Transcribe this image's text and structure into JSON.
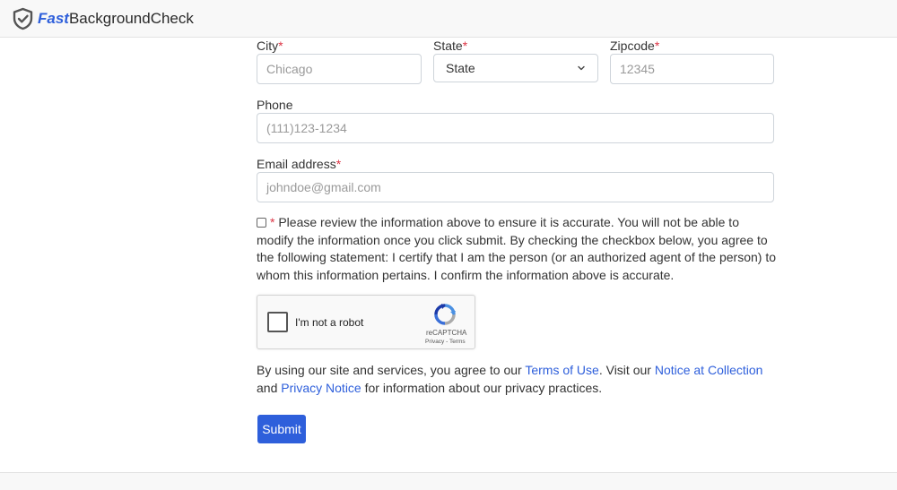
{
  "header": {
    "logo_fast": "Fast",
    "logo_rest": "BackgroundCheck",
    "brand_color": "#2e5fdb"
  },
  "form": {
    "city": {
      "label": "City",
      "required_mark": "*",
      "placeholder": "Chicago"
    },
    "state": {
      "label": "State",
      "required_mark": "*",
      "selected": "State"
    },
    "zipcode": {
      "label": "Zipcode",
      "required_mark": "*",
      "placeholder": "12345"
    },
    "phone": {
      "label": "Phone",
      "placeholder": "(111)123-1234"
    },
    "email": {
      "label": "Email address",
      "required_mark": "*",
      "placeholder": "johndoe@gmail.com"
    },
    "consent": {
      "required_mark": "*",
      "text": "Please review the information above to ensure it is accurate. You will not be able to modify the information once you click submit. By checking the checkbox below, you agree to the following statement: I certify that I am the person (or an authorized agent of the person) to whom this information pertains. I confirm the information above is accurate."
    },
    "captcha": {
      "label": "I'm not a robot",
      "brand": "reCAPTCHA",
      "privacy": "Privacy",
      "separator": " - ",
      "terms": "Terms"
    },
    "terms_notice": {
      "part1": "By using our site and services, you agree to our ",
      "terms_link": "Terms of Use",
      "part2": ". Visit our ",
      "notice_link": "Notice at Collection",
      "part3": " and ",
      "privacy_link": "Privacy Notice",
      "part4": " for information about our privacy practices."
    },
    "submit_label": "Submit"
  },
  "colors": {
    "required": "#dc3545",
    "link": "#2e5fdb",
    "button": "#2e5fdb"
  }
}
